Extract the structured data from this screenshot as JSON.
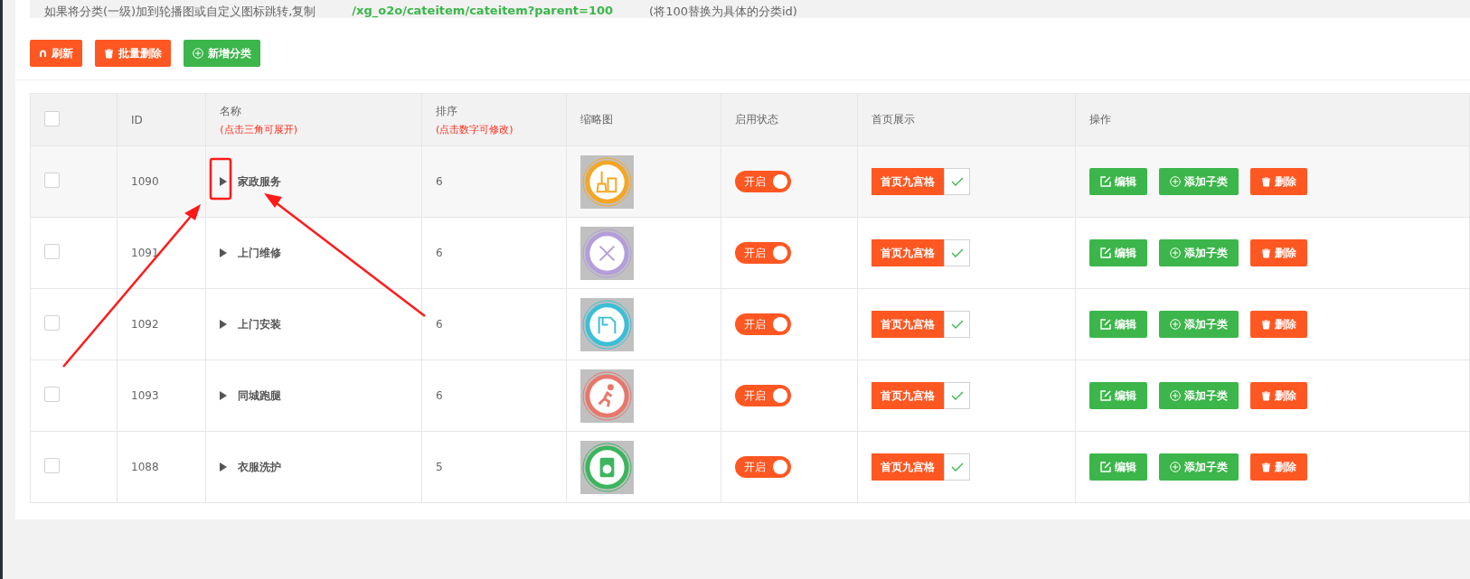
{
  "notice": {
    "text": "如果将分类(一级)加到轮播图或自定义图标跳转,复制",
    "link": "/xg_o2o/cateitem/cateitem?parent=100",
    "note": "(将100替换为具体的分类id)"
  },
  "toolbar": [
    {
      "kind": "refresh",
      "label": "刷新"
    },
    {
      "kind": "delete",
      "label": "批量删除"
    },
    {
      "kind": "add",
      "label": "新增分类"
    }
  ],
  "table": {
    "header_checked": false,
    "columns": [
      {
        "title": "ID"
      },
      {
        "title": "名称",
        "hint": "(点击三角可展开)"
      },
      {
        "title": "排序",
        "hint": "(点击数字可修改)"
      },
      {
        "title": "缩略图"
      },
      {
        "title": "启用状态"
      },
      {
        "title": "首页展示"
      },
      {
        "title": "操作"
      }
    ],
    "rows": [
      {
        "checked": false,
        "id": "1090",
        "expanded": false,
        "name": "家政服务",
        "sort": "6",
        "color": "#f5a623",
        "status": {
          "on": true,
          "label": "开启"
        },
        "home": {
          "label": "首页九宫格",
          "checked": true
        },
        "actions": [
          {
            "kind": "edit",
            "label": "编辑"
          },
          {
            "kind": "add",
            "label": "添加子类"
          },
          {
            "kind": "delete",
            "label": "删除"
          }
        ]
      },
      {
        "checked": false,
        "id": "1091",
        "expanded": false,
        "name": "上门维修",
        "sort": "6",
        "color": "#b39ddb",
        "status": {
          "on": true,
          "label": "开启"
        },
        "home": {
          "label": "首页九宫格",
          "checked": true
        },
        "actions": [
          {
            "kind": "edit",
            "label": "编辑"
          },
          {
            "kind": "add",
            "label": "添加子类"
          },
          {
            "kind": "delete",
            "label": "删除"
          }
        ]
      },
      {
        "checked": false,
        "id": "1092",
        "expanded": false,
        "name": "上门安装",
        "sort": "6",
        "color": "#3bbfd6",
        "status": {
          "on": true,
          "label": "开启"
        },
        "home": {
          "label": "首页九宫格",
          "checked": true
        },
        "actions": [
          {
            "kind": "edit",
            "label": "编辑"
          },
          {
            "kind": "add",
            "label": "添加子类"
          },
          {
            "kind": "delete",
            "label": "删除"
          }
        ]
      },
      {
        "checked": false,
        "id": "1093",
        "expanded": false,
        "name": "同城跑腿",
        "sort": "6",
        "color": "#e8776b",
        "status": {
          "on": true,
          "label": "开启"
        },
        "home": {
          "label": "首页九宫格",
          "checked": true
        },
        "actions": [
          {
            "kind": "edit",
            "label": "编辑"
          },
          {
            "kind": "add",
            "label": "添加子类"
          },
          {
            "kind": "delete",
            "label": "删除"
          }
        ]
      },
      {
        "checked": false,
        "id": "1088",
        "expanded": false,
        "name": "衣服洗护",
        "sort": "5",
        "color": "#3cb55e",
        "status": {
          "on": true,
          "label": "开启"
        },
        "home": {
          "label": "首页九宫格",
          "checked": true
        },
        "actions": [
          {
            "kind": "edit",
            "label": "编辑"
          },
          {
            "kind": "add",
            "label": "添加子类"
          },
          {
            "kind": "delete",
            "label": "删除"
          }
        ]
      }
    ]
  }
}
